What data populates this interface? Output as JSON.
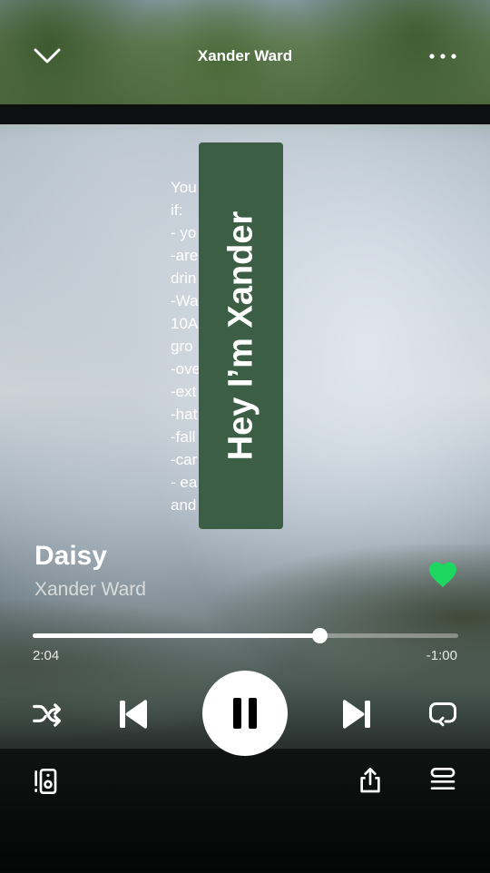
{
  "header": {
    "title": "Xander Ward",
    "collapse_icon": "chevron-down-icon",
    "more_icon": "more-horizontal-icon"
  },
  "video_overlay": {
    "lyrics": "You          my music\nif:\n- yo              beach\n-are              f fruity\ndrin\n-Wa              elodeon\n10A              aturday\ngro\n-ove              e coffee\n-ext              stalgic\n-hat\n-fall              fast\n-car              esson\n- ea              t for dinner\nand              ast",
    "sticker_text": "Hey I’m Xander",
    "sticker_color": "#3c5e45"
  },
  "track": {
    "title": "Daisy",
    "artist": "Xander Ward",
    "liked": true,
    "like_icon": "heart-filled-icon",
    "like_color": "#1ed760"
  },
  "playback": {
    "elapsed": "2:04",
    "remaining": "-1:00",
    "progress_fraction": 0.674
  },
  "controls": {
    "shuffle_icon": "shuffle-icon",
    "previous_icon": "skip-previous-icon",
    "play_pause_icon": "pause-icon",
    "next_icon": "skip-next-icon",
    "repeat_icon": "repeat-icon"
  },
  "footer": {
    "devices_icon": "connect-devices-icon",
    "share_icon": "share-icon",
    "queue_icon": "queue-icon"
  }
}
